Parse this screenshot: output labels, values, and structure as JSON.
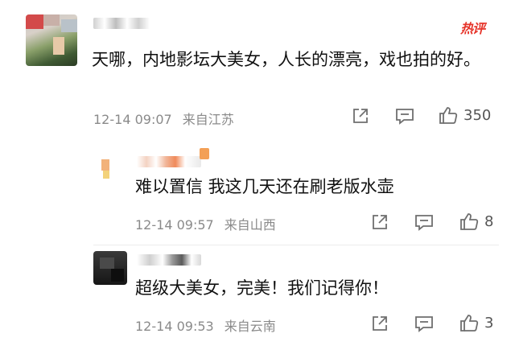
{
  "hot_badge": "热评",
  "comments": [
    {
      "text": "天哪，内地影坛大美女，人长的漂亮，戏也拍的好。",
      "time": "12-14 09:07",
      "location": "来自江苏",
      "likes": "350"
    },
    {
      "text": "难以置信 我这几天还在刷老版水壶",
      "time": "12-14 09:57",
      "location": "来自山西",
      "likes": "8"
    },
    {
      "text": "超级大美女，完美！我们记得你！",
      "time": "12-14 09:53",
      "location": "来自云南",
      "likes": "3"
    }
  ],
  "colors": {
    "hot_badge": "#e6342a",
    "meta_text": "#8a8a8a",
    "icon_stroke": "#6f6f6f"
  },
  "icons": [
    "share-icon",
    "comment-icon",
    "like-icon"
  ]
}
